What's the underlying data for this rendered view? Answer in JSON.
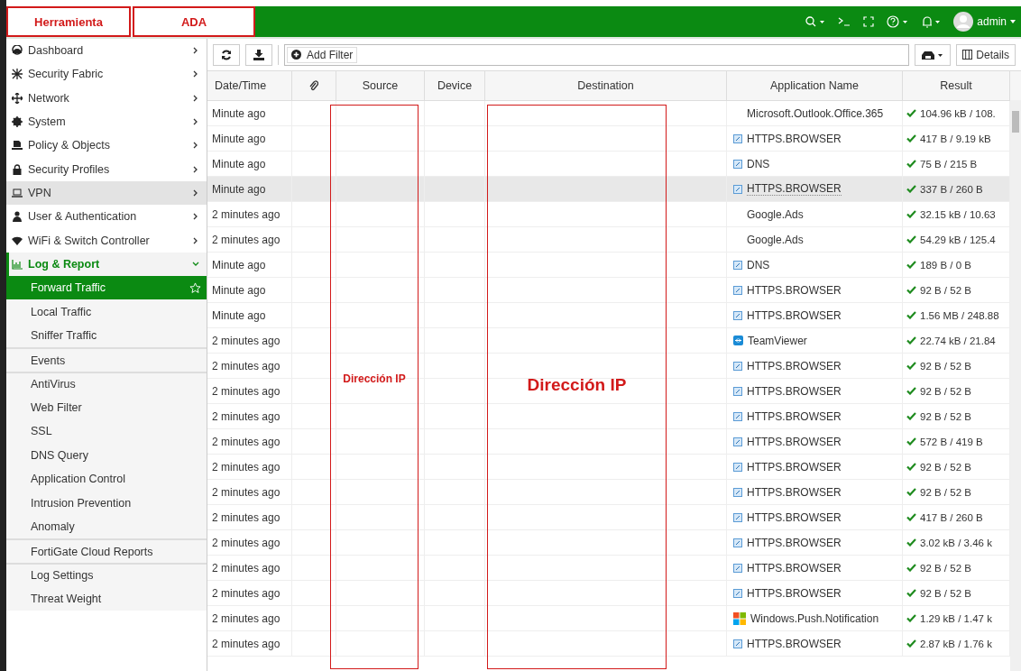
{
  "top_bar": {
    "annotations": [
      "Herramienta",
      "ADA"
    ],
    "user": "admin"
  },
  "sidebar": {
    "items": [
      {
        "label": "Dashboard",
        "selected": false,
        "highlighted": false,
        "expanded": false
      },
      {
        "label": "Security Fabric",
        "selected": false,
        "highlighted": false,
        "expanded": false
      },
      {
        "label": "Network",
        "selected": false,
        "highlighted": false,
        "expanded": false
      },
      {
        "label": "System",
        "selected": false,
        "highlighted": false,
        "expanded": false
      },
      {
        "label": "Policy & Objects",
        "selected": false,
        "highlighted": false,
        "expanded": false
      },
      {
        "label": "Security Profiles",
        "selected": false,
        "highlighted": false,
        "expanded": false
      },
      {
        "label": "VPN",
        "selected": false,
        "highlighted": true,
        "expanded": false
      },
      {
        "label": "User & Authentication",
        "selected": false,
        "highlighted": false,
        "expanded": false
      },
      {
        "label": "WiFi & Switch Controller",
        "selected": false,
        "highlighted": false,
        "expanded": false
      },
      {
        "label": "Log & Report",
        "selected": true,
        "highlighted": false,
        "expanded": true,
        "children": [
          {
            "label": "Forward Traffic",
            "selected": true,
            "divider_before": false
          },
          {
            "label": "Local Traffic",
            "selected": false,
            "divider_before": false
          },
          {
            "label": "Sniffer Traffic",
            "selected": false,
            "divider_before": false
          },
          {
            "label": "Events",
            "selected": false,
            "divider_before": true
          },
          {
            "label": "AntiVirus",
            "selected": false,
            "divider_before": true
          },
          {
            "label": "Web Filter",
            "selected": false,
            "divider_before": false
          },
          {
            "label": "SSL",
            "selected": false,
            "divider_before": false
          },
          {
            "label": "DNS Query",
            "selected": false,
            "divider_before": false
          },
          {
            "label": "Application Control",
            "selected": false,
            "divider_before": false
          },
          {
            "label": "Intrusion Prevention",
            "selected": false,
            "divider_before": false
          },
          {
            "label": "Anomaly",
            "selected": false,
            "divider_before": false
          },
          {
            "label": "FortiGate Cloud Reports",
            "selected": false,
            "divider_before": true
          },
          {
            "label": "Log Settings",
            "selected": false,
            "divider_before": true
          },
          {
            "label": "Threat Weight",
            "selected": false,
            "divider_before": false
          }
        ]
      }
    ]
  },
  "toolbar": {
    "filter_button": "Add Filter",
    "details_button": "Details"
  },
  "table": {
    "columns": [
      "Date/Time",
      "",
      "Source",
      "Device",
      "Destination",
      "Application Name",
      "Result"
    ],
    "rows": [
      {
        "time": "Minute ago",
        "app": "Microsoft.Outlook.Office.365",
        "kind": "none",
        "result": "104.96 kB / 108.",
        "highlighted": false
      },
      {
        "time": "Minute ago",
        "app": "HTTPS.BROWSER",
        "kind": "generic",
        "result": "417 B / 9.19 kB",
        "highlighted": false
      },
      {
        "time": "Minute ago",
        "app": "DNS",
        "kind": "generic",
        "result": "75 B / 215 B",
        "highlighted": false
      },
      {
        "time": "Minute ago",
        "app": "HTTPS.BROWSER",
        "kind": "generic",
        "result": "337 B / 260 B",
        "highlighted": true
      },
      {
        "time": "2 minutes ago",
        "app": "Google.Ads",
        "kind": "none",
        "result": "32.15 kB / 10.63",
        "highlighted": false
      },
      {
        "time": "2 minutes ago",
        "app": "Google.Ads",
        "kind": "none",
        "result": "54.29 kB / 125.4",
        "highlighted": false
      },
      {
        "time": "Minute ago",
        "app": "DNS",
        "kind": "generic",
        "result": "189 B / 0 B",
        "highlighted": false
      },
      {
        "time": "Minute ago",
        "app": "HTTPS.BROWSER",
        "kind": "generic",
        "result": "92 B / 52 B",
        "highlighted": false
      },
      {
        "time": "Minute ago",
        "app": "HTTPS.BROWSER",
        "kind": "generic",
        "result": "1.56 MB / 248.88",
        "highlighted": false
      },
      {
        "time": "2 minutes ago",
        "app": "TeamViewer",
        "kind": "teamviewer",
        "result": "22.74 kB / 21.84",
        "highlighted": false
      },
      {
        "time": "2 minutes ago",
        "app": "HTTPS.BROWSER",
        "kind": "generic",
        "result": "92 B / 52 B",
        "highlighted": false
      },
      {
        "time": "2 minutes ago",
        "app": "HTTPS.BROWSER",
        "kind": "generic",
        "result": "92 B / 52 B",
        "highlighted": false
      },
      {
        "time": "2 minutes ago",
        "app": "HTTPS.BROWSER",
        "kind": "generic",
        "result": "92 B / 52 B",
        "highlighted": false
      },
      {
        "time": "2 minutes ago",
        "app": "HTTPS.BROWSER",
        "kind": "generic",
        "result": "572 B / 419 B",
        "highlighted": false
      },
      {
        "time": "2 minutes ago",
        "app": "HTTPS.BROWSER",
        "kind": "generic",
        "result": "92 B / 52 B",
        "highlighted": false
      },
      {
        "time": "2 minutes ago",
        "app": "HTTPS.BROWSER",
        "kind": "generic",
        "result": "92 B / 52 B",
        "highlighted": false
      },
      {
        "time": "2 minutes ago",
        "app": "HTTPS.BROWSER",
        "kind": "generic",
        "result": "417 B / 260 B",
        "highlighted": false
      },
      {
        "time": "2 minutes ago",
        "app": "HTTPS.BROWSER",
        "kind": "generic",
        "result": "3.02 kB / 3.46 k",
        "highlighted": false
      },
      {
        "time": "2 minutes ago",
        "app": "HTTPS.BROWSER",
        "kind": "generic",
        "result": "92 B / 52 B",
        "highlighted": false
      },
      {
        "time": "2 minutes ago",
        "app": "HTTPS.BROWSER",
        "kind": "generic",
        "result": "92 B / 52 B",
        "highlighted": false
      },
      {
        "time": "2 minutes ago",
        "app": "Windows.Push.Notification",
        "kind": "windows",
        "result": "1.29 kB / 1.47 k",
        "highlighted": false
      },
      {
        "time": "2 minutes ago",
        "app": "HTTPS.BROWSER",
        "kind": "generic",
        "result": "2.87 kB / 1.76 k",
        "highlighted": false
      }
    ]
  },
  "annotations": {
    "source": "Dirección IP",
    "destination": "Dirección IP"
  }
}
